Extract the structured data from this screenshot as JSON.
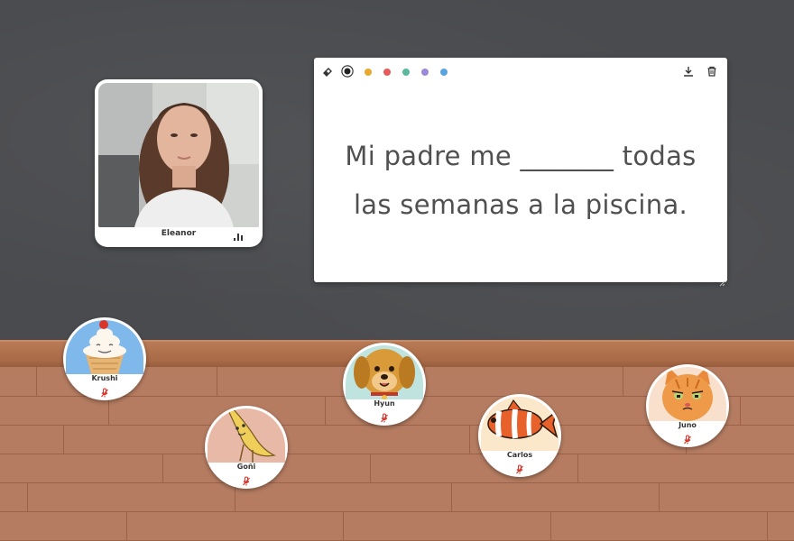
{
  "video": {
    "name": "Eleanor"
  },
  "whiteboard": {
    "line1": "Mi padre me _______ todas",
    "line2": "las semanas a la piscina.",
    "colors": [
      "#222222",
      "#e8a92e",
      "#e85a5a",
      "#5ab89c",
      "#9b8ad8",
      "#5aa2e0"
    ]
  },
  "participants": [
    {
      "name": "Krushi",
      "icon": "ice-cream-avatar"
    },
    {
      "name": "Goñi",
      "icon": "banana-avatar"
    },
    {
      "name": "Hyun",
      "icon": "dog-avatar"
    },
    {
      "name": "Carlos",
      "icon": "clownfish-avatar"
    },
    {
      "name": "Juno",
      "icon": "cat-avatar"
    }
  ]
}
